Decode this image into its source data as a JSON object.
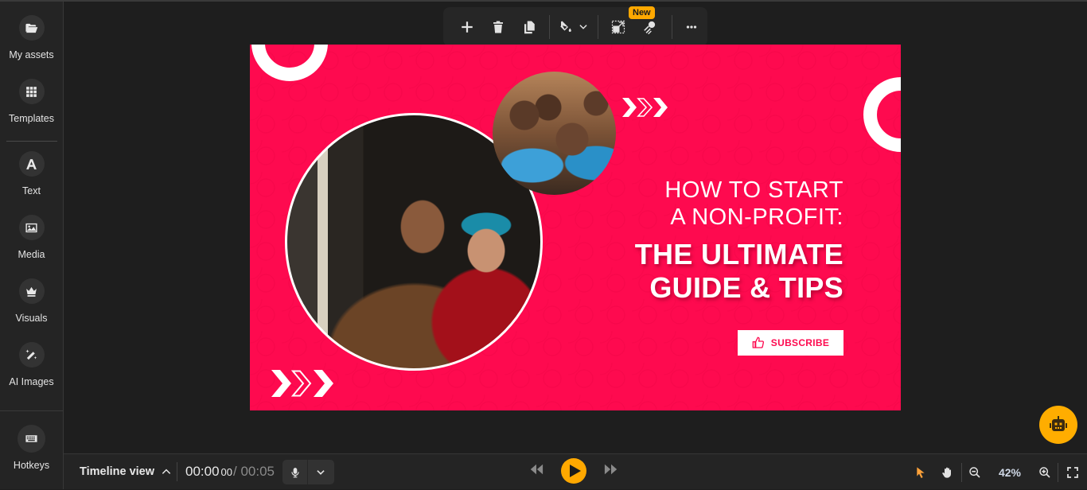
{
  "sidebar": {
    "items": [
      {
        "label": "My assets",
        "icon": "folder-open-icon"
      },
      {
        "label": "Templates",
        "icon": "grid-icon"
      },
      {
        "label": "Text",
        "icon": "text-icon"
      },
      {
        "label": "Media",
        "icon": "image-icon"
      },
      {
        "label": "Visuals",
        "icon": "crown-icon"
      },
      {
        "label": "AI Images",
        "icon": "magic-wand-icon"
      }
    ],
    "hotkeys": {
      "label": "Hotkeys",
      "icon": "keyboard-icon"
    }
  },
  "toolbar": {
    "buttons": [
      "add",
      "delete",
      "duplicate",
      "fill-color",
      "resize",
      "ai-effect",
      "more"
    ],
    "new_badge": "New"
  },
  "canvas": {
    "background_color": "#fe0a4f",
    "headline_line1": "HOW TO START",
    "headline_line2": "A NON-PROFIT:",
    "headline_bold1": "THE ULTIMATE",
    "headline_bold2": "GUIDE & TIPS",
    "subscribe_label": "SUBSCRIBE",
    "photos": [
      "woman holding child",
      "group of smiling children"
    ]
  },
  "bottombar": {
    "timeline_label": "Timeline view",
    "current_time": "00:00",
    "current_frames": "00",
    "total_time": "/ 00:05",
    "zoom_level": "42%"
  },
  "colors": {
    "accent": "#ffa800",
    "canvas_pink": "#fe0a4f",
    "panel": "#242424",
    "workspace": "#1e1e1e"
  }
}
